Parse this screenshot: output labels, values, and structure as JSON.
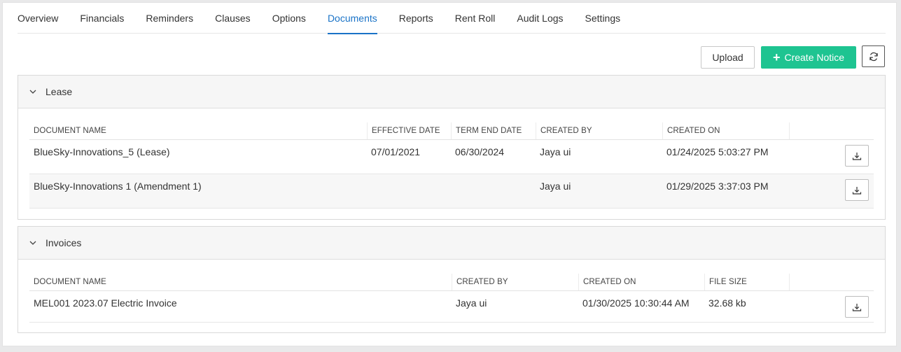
{
  "tabs": [
    {
      "label": "Overview"
    },
    {
      "label": "Financials"
    },
    {
      "label": "Reminders"
    },
    {
      "label": "Clauses"
    },
    {
      "label": "Options"
    },
    {
      "label": "Documents"
    },
    {
      "label": "Reports"
    },
    {
      "label": "Rent Roll"
    },
    {
      "label": "Audit Logs"
    },
    {
      "label": "Settings"
    }
  ],
  "active_tab": "Documents",
  "toolbar": {
    "upload_label": "Upload",
    "create_notice_label": "Create Notice",
    "refresh_icon": "refresh-icon"
  },
  "colors": {
    "accent": "#1a73c7",
    "create_button": "#1ec491"
  },
  "lease": {
    "title": "Lease",
    "columns": [
      "DOCUMENT NAME",
      "EFFECTIVE DATE",
      "TERM END DATE",
      "CREATED BY",
      "CREATED ON"
    ],
    "rows": [
      {
        "name": "BlueSky-Innovations_5 (Lease)",
        "effective": "07/01/2021",
        "term_end": "06/30/2024",
        "created_by": "Jaya ui",
        "created_on": "01/24/2025 5:03:27 PM"
      },
      {
        "name": "BlueSky-Innovations 1 (Amendment 1)",
        "effective": "",
        "term_end": "",
        "created_by": "Jaya ui",
        "created_on": "01/29/2025 3:37:03 PM"
      }
    ]
  },
  "invoices": {
    "title": "Invoices",
    "columns": [
      "DOCUMENT NAME",
      "CREATED BY",
      "CREATED ON",
      "FILE SIZE"
    ],
    "rows": [
      {
        "name": "MEL001 2023.07 Electric Invoice",
        "created_by": "Jaya ui",
        "created_on": "01/30/2025 10:30:44 AM",
        "file_size": "32.68 kb"
      }
    ]
  }
}
